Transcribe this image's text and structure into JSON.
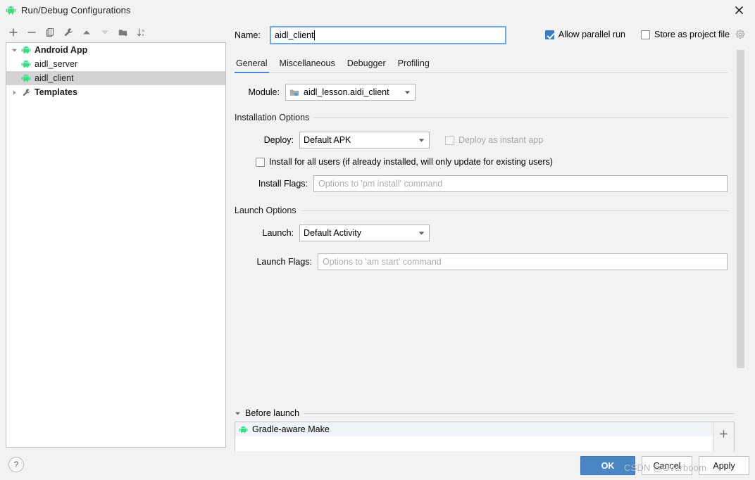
{
  "window": {
    "title": "Run/Debug Configurations",
    "icon": "android-icon",
    "close_icon": "close-icon"
  },
  "tree_toolbar": {
    "buttons": [
      {
        "name": "add-configuration-button",
        "icon": "plus-icon",
        "enabled": true
      },
      {
        "name": "remove-configuration-button",
        "icon": "minus-icon",
        "enabled": true
      },
      {
        "name": "copy-configuration-button",
        "icon": "copy-icon",
        "enabled": true
      },
      {
        "name": "edit-templates-button",
        "icon": "wrench-icon",
        "enabled": true
      },
      {
        "name": "move-up-button",
        "icon": "arrow-up-icon",
        "enabled": true
      },
      {
        "name": "move-down-button",
        "icon": "arrow-down-icon",
        "enabled": false
      },
      {
        "name": "move-into-folder-button",
        "icon": "folder-add-icon",
        "enabled": true
      },
      {
        "name": "sort-configurations-button",
        "icon": "sort-az-icon",
        "enabled": true
      }
    ]
  },
  "tree": {
    "nodes": [
      {
        "label": "Android App",
        "icon": "android-icon",
        "twisty": "expanded",
        "bold": true,
        "depth": 0,
        "selected": false
      },
      {
        "label": "aidl_server",
        "icon": "android-icon",
        "twisty": "none",
        "bold": false,
        "depth": 1,
        "selected": false
      },
      {
        "label": "aidl_client",
        "icon": "android-icon",
        "twisty": "none",
        "bold": false,
        "depth": 1,
        "selected": true
      },
      {
        "label": "Templates",
        "icon": "wrench-icon",
        "twisty": "collapsed",
        "bold": true,
        "depth": 0,
        "selected": false
      }
    ]
  },
  "name_row": {
    "label": "Name:",
    "value": "aidl_client",
    "placeholder": ""
  },
  "top_checks": {
    "allow_parallel_run": {
      "label": "Allow parallel run",
      "checked": true,
      "enabled": true
    },
    "store_as_project_file": {
      "label": "Store as project file",
      "checked": false,
      "enabled": true
    },
    "settings_icon": "gear-icon"
  },
  "tabs": [
    {
      "label": "General",
      "active": true
    },
    {
      "label": "Miscellaneous",
      "active": false
    },
    {
      "label": "Debugger",
      "active": false
    },
    {
      "label": "Profiling",
      "active": false
    }
  ],
  "module_row": {
    "label": "Module:",
    "value": "aidl_lesson.aidi_client",
    "icon": "module-folder-icon"
  },
  "installation_options": {
    "title": "Installation Options",
    "deploy": {
      "label": "Deploy:",
      "value": "Default APK"
    },
    "deploy_instant_app": {
      "label": "Deploy as instant app",
      "checked": false,
      "enabled": false
    },
    "install_all_users": {
      "label": "Install for all users (if already installed, will only update for existing users)",
      "checked": false,
      "enabled": true
    },
    "install_flags": {
      "label": "Install Flags:",
      "value": "",
      "placeholder": "Options to 'pm install' command"
    }
  },
  "launch_options": {
    "title": "Launch Options",
    "launch": {
      "label": "Launch:",
      "value": "Default Activity"
    },
    "launch_flags": {
      "label": "Launch Flags:",
      "value": "",
      "placeholder": "Options to 'am start' command"
    }
  },
  "before_launch": {
    "title": "Before launch",
    "twisty": "expanded",
    "items": [
      {
        "label": "Gradle-aware Make",
        "icon": "android-icon"
      }
    ],
    "add_button_icon": "plus-icon"
  },
  "bottom_bar": {
    "help_label": "?",
    "ok_label": "OK",
    "cancel_label": "Cancel",
    "apply_label": "Apply"
  },
  "watermark": "CSDN @Overboom",
  "colors": {
    "accent": "#4a86c5",
    "tab_underline": "#4a88c7",
    "checkbox_checked": "#3d7ebf",
    "android_green": "#3ddc84",
    "selection": "#d4d4d4",
    "window_bg": "#f2f2f2",
    "field_focus_border": "#6fa9dd"
  }
}
